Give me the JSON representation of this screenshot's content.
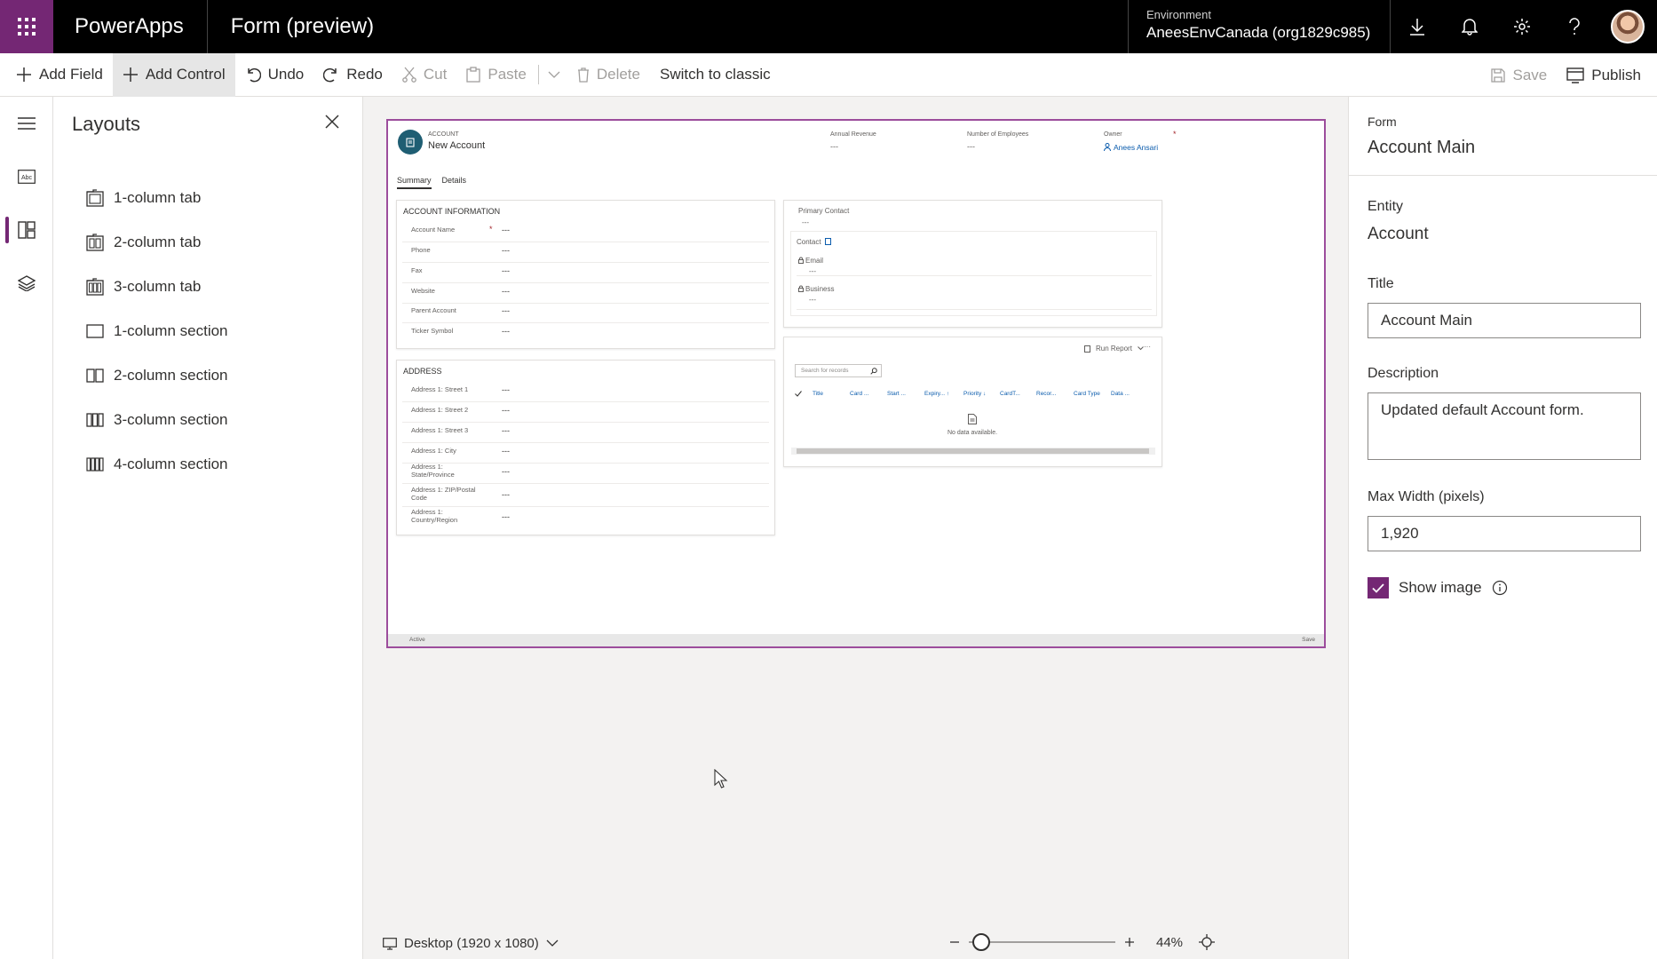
{
  "header": {
    "app_name": "PowerApps",
    "doc_name": "Form (preview)",
    "environment_label": "Environment",
    "environment_value": "AneesEnvCanada (org1829c985)"
  },
  "toolbar": {
    "add_field": "Add Field",
    "add_control": "Add Control",
    "undo": "Undo",
    "redo": "Redo",
    "cut": "Cut",
    "paste": "Paste",
    "delete": "Delete",
    "switch_classic": "Switch to classic",
    "save": "Save",
    "publish": "Publish"
  },
  "layouts": {
    "title": "Layouts",
    "items": [
      {
        "label": "1-column tab"
      },
      {
        "label": "2-column tab"
      },
      {
        "label": "3-column tab"
      },
      {
        "label": "1-column section"
      },
      {
        "label": "2-column section"
      },
      {
        "label": "3-column section"
      },
      {
        "label": "4-column section"
      }
    ]
  },
  "form": {
    "entity_kicker": "ACCOUNT",
    "record_title": "New Account",
    "header_fields": [
      {
        "label": "Annual Revenue",
        "value": "---"
      },
      {
        "label": "Number of Employees",
        "value": "---"
      },
      {
        "label": "Owner",
        "value": "Anees Ansari"
      }
    ],
    "tabs": [
      "Summary",
      "Details"
    ],
    "account_info": {
      "title": "ACCOUNT INFORMATION",
      "rows": [
        {
          "label": "Account Name",
          "value": "---"
        },
        {
          "label": "Phone",
          "value": "---"
        },
        {
          "label": "Fax",
          "value": "---"
        },
        {
          "label": "Website",
          "value": "---"
        },
        {
          "label": "Parent Account",
          "value": "---"
        },
        {
          "label": "Ticker Symbol",
          "value": "---"
        }
      ]
    },
    "address": {
      "title": "ADDRESS",
      "rows": [
        {
          "label": "Address 1: Street 1",
          "value": "---"
        },
        {
          "label": "Address 1: Street 2",
          "value": "---"
        },
        {
          "label": "Address 1: Street 3",
          "value": "---"
        },
        {
          "label": "Address 1: City",
          "value": "---"
        },
        {
          "label": "Address 1: State/Province",
          "value": "---"
        },
        {
          "label": "Address 1: ZIP/Postal Code",
          "value": "---"
        },
        {
          "label": "Address 1: Country/Region",
          "value": "---"
        }
      ]
    },
    "primary_contact": {
      "label": "Primary Contact",
      "value": "---",
      "contact_label": "Contact",
      "email_label": "Email",
      "email_value": "---",
      "business_label": "Business",
      "business_value": "---"
    },
    "grid": {
      "run_report": "Run Report",
      "more": "···",
      "search_placeholder": "Search for records",
      "columns": [
        "Title",
        "Card ...",
        "Start ...",
        "Expiry... ↑",
        "Priority ↓",
        "CardT...",
        "Recor...",
        "Card Type",
        "Data ..."
      ],
      "empty_text": "No data available."
    },
    "footer_status": "Active",
    "footer_save": "Save"
  },
  "canvas": {
    "device": "Desktop (1920 x 1080)",
    "zoom": "44%"
  },
  "properties": {
    "kicker": "Form",
    "title": "Account Main",
    "entity_label": "Entity",
    "entity_value": "Account",
    "title_label": "Title",
    "title_value": "Account Main",
    "description_label": "Description",
    "description_value": "Updated default Account form.",
    "max_width_label": "Max Width (pixels)",
    "max_width_value": "1,920",
    "show_image_label": "Show image"
  }
}
